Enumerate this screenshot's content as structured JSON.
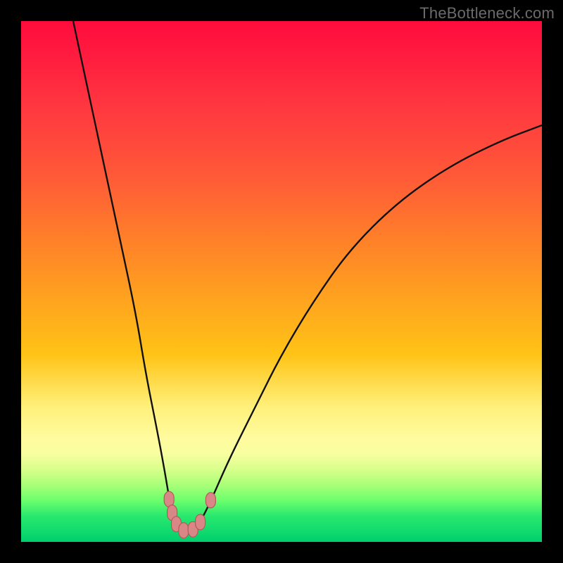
{
  "watermark": "TheBottleneck.com",
  "chart_data": {
    "type": "line",
    "title": "",
    "xlabel": "",
    "ylabel": "",
    "xlim": [
      0,
      100
    ],
    "ylim": [
      0,
      100
    ],
    "grid": false,
    "series": [
      {
        "name": "curve",
        "x": [
          10,
          13,
          16,
          19,
          22,
          24,
          26,
          27.5,
          28.5,
          29.2,
          30,
          31,
          32,
          33,
          34.5,
          36.5,
          40,
          45,
          50,
          56,
          63,
          72,
          82,
          92,
          100
        ],
        "y": [
          100,
          86,
          72,
          58,
          44,
          32,
          22,
          14,
          8,
          4,
          2.2,
          2.0,
          2.0,
          2.4,
          4,
          8,
          16,
          26,
          36,
          46,
          56,
          65,
          72,
          77,
          80
        ]
      }
    ],
    "markers": [
      {
        "x": 28.4,
        "y": 8.2
      },
      {
        "x": 29.0,
        "y": 5.6
      },
      {
        "x": 29.8,
        "y": 3.4
      },
      {
        "x": 31.2,
        "y": 2.2
      },
      {
        "x": 33.0,
        "y": 2.4
      },
      {
        "x": 34.4,
        "y": 3.8
      },
      {
        "x": 36.4,
        "y": 8.0
      }
    ],
    "gradient_stops": [
      {
        "pos": 0,
        "color": "#ff0c3c"
      },
      {
        "pos": 30,
        "color": "#ff5a37"
      },
      {
        "pos": 64,
        "color": "#ffc316"
      },
      {
        "pos": 80,
        "color": "#fffb9e"
      },
      {
        "pos": 92,
        "color": "#6cff6c"
      },
      {
        "pos": 100,
        "color": "#00cf6e"
      }
    ]
  }
}
